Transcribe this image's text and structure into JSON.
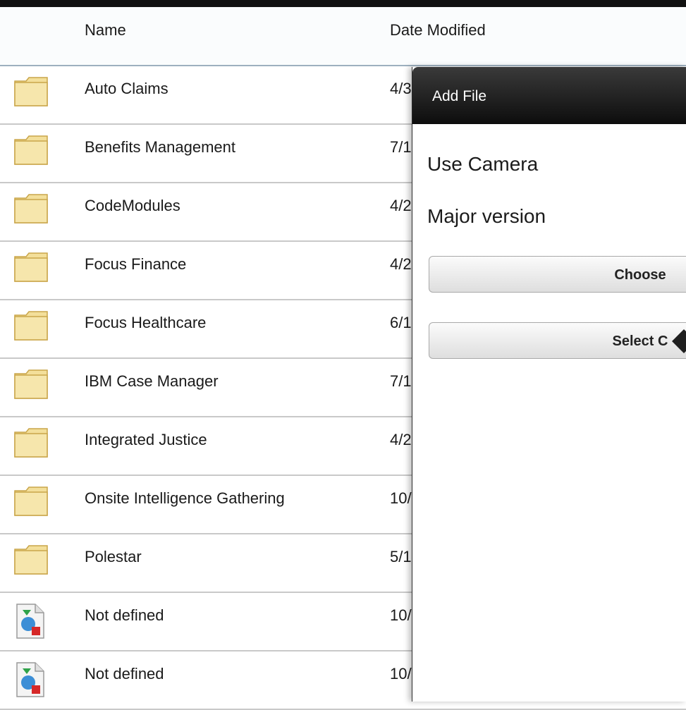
{
  "file_list": {
    "columns": {
      "name": "Name",
      "date_modified": "Date Modified"
    },
    "rows": [
      {
        "icon": "folder-icon",
        "name": "Auto Claims",
        "date": "4/3"
      },
      {
        "icon": "folder-icon",
        "name": "Benefits Management",
        "date": "7/1"
      },
      {
        "icon": "folder-icon",
        "name": "CodeModules",
        "date": "4/2"
      },
      {
        "icon": "folder-icon",
        "name": "Focus Finance",
        "date": "4/2"
      },
      {
        "icon": "folder-icon",
        "name": "Focus Healthcare",
        "date": "6/1"
      },
      {
        "icon": "folder-icon",
        "name": "IBM Case Manager",
        "date": "7/1"
      },
      {
        "icon": "folder-icon",
        "name": "Integrated Justice",
        "date": "4/2"
      },
      {
        "icon": "folder-icon",
        "name": "Onsite Intelligence Gathering",
        "date": "10/"
      },
      {
        "icon": "folder-icon",
        "name": "Polestar",
        "date": "5/1"
      },
      {
        "icon": "document-icon",
        "name": "Not defined",
        "date": "10/"
      },
      {
        "icon": "document-icon",
        "name": "Not defined",
        "date": "10/"
      }
    ]
  },
  "add_file_popover": {
    "title": "Add File",
    "use_camera_label": "Use Camera",
    "major_version_label": "Major version",
    "choose_button_label": "Choose",
    "select_button_label": "Select C"
  },
  "colors": {
    "folder": "#f3df9a",
    "popover_header": "#1a1a1a",
    "row_divider": "#c9c9c9"
  }
}
